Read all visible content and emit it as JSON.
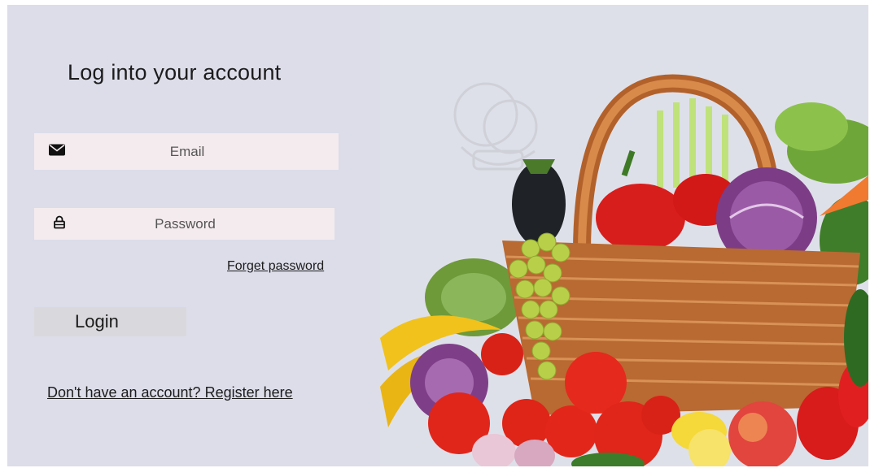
{
  "login": {
    "title": "Log into your account",
    "email_placeholder": "Email",
    "password_placeholder": "Password",
    "forget_password": "Forget password",
    "login_button": "Login",
    "register_link": "Don't have an account? Register here"
  },
  "icons": {
    "email": "envelope-icon",
    "password": "lock-icon"
  },
  "colors": {
    "left_panel": "#dcdde9",
    "input_bg": "#f4ebee",
    "button_bg": "#d9d9dd",
    "text": "#1c1c1c"
  }
}
